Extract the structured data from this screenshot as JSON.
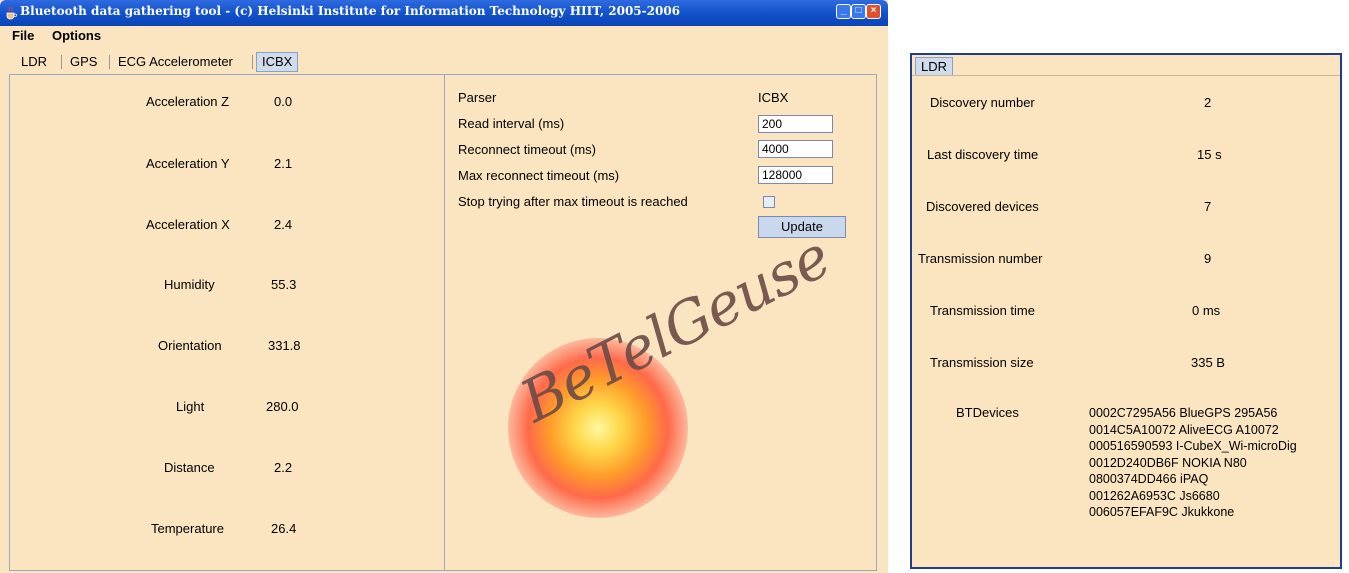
{
  "window": {
    "title": "Bluetooth data gathering tool - (c) Helsinki Institute for Information Technology HIIT, 2005-2006",
    "buttons": {
      "minimize": "_",
      "maximize": "□",
      "close": "×"
    }
  },
  "menubar": {
    "file": "File",
    "options": "Options"
  },
  "tabs": [
    {
      "label": "LDR",
      "active": false
    },
    {
      "label": "GPS",
      "active": false
    },
    {
      "label": "ECG Accelerometer",
      "active": false
    },
    {
      "label": "ICBX",
      "active": true
    }
  ],
  "sensors": [
    {
      "label": "Acceleration Z",
      "value": "0.0"
    },
    {
      "label": "Acceleration Y",
      "value": "2.1"
    },
    {
      "label": "Acceleration X",
      "value": "2.4"
    },
    {
      "label": "Humidity",
      "value": "55.3"
    },
    {
      "label": "Orientation",
      "value": "331.8"
    },
    {
      "label": "Light",
      "value": "280.0"
    },
    {
      "label": "Distance",
      "value": "2.2"
    },
    {
      "label": "Temperature",
      "value": "26.4"
    }
  ],
  "settings": {
    "parser_label": "Parser",
    "parser_value": "ICBX",
    "read_interval_label": "Read interval (ms)",
    "read_interval_value": "200",
    "reconnect_timeout_label": "Reconnect timeout (ms)",
    "reconnect_timeout_value": "4000",
    "max_reconnect_label": "Max reconnect timeout (ms)",
    "max_reconnect_value": "128000",
    "stop_trying_label": "Stop trying after max timeout is reached",
    "stop_trying_checked": false,
    "update_button": "Update"
  },
  "logo": {
    "text": "BeTelGeuse"
  },
  "ldr_panel": {
    "tab": "LDR",
    "rows": [
      {
        "label": "Discovery number",
        "value": "2"
      },
      {
        "label": "Last discovery time",
        "value": "15 s"
      },
      {
        "label": "Discovered devices",
        "value": "7"
      },
      {
        "label": "Transmission number",
        "value": "9"
      },
      {
        "label": "Transmission time",
        "value": "0 ms"
      },
      {
        "label": "Transmission size",
        "value": "335 B"
      }
    ],
    "btdevices_label": "BTDevices",
    "btdevices": [
      "0002C7295A56 BlueGPS 295A56",
      "0014C5A10072 AliveECG A10072",
      "000516590593 I-CubeX_Wi-microDig",
      "0012D240DB6F NOKIA N80",
      "0800374DD466 iPAQ",
      "001262A6953C Js6680",
      "006057EFAF9C Jkukkone"
    ]
  }
}
